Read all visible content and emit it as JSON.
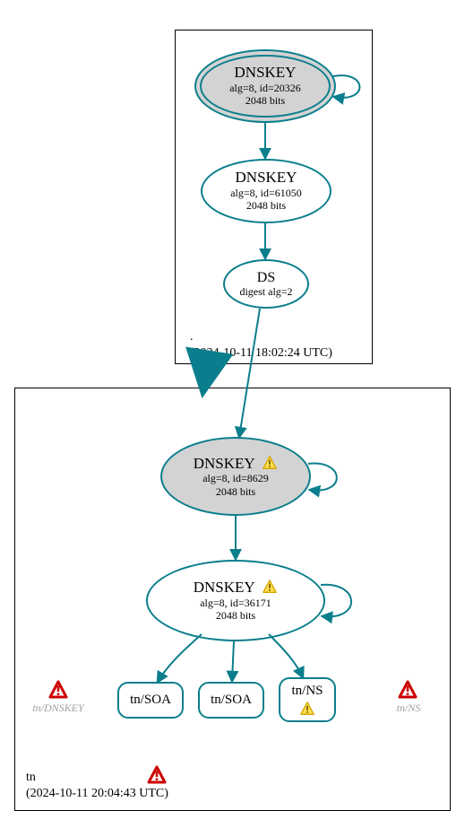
{
  "cluster_root": {
    "name": ".",
    "timestamp": "(2024-10-11 18:02:24 UTC)"
  },
  "cluster_tn": {
    "name": "tn",
    "timestamp": "(2024-10-11 20:04:43 UTC)"
  },
  "nodes": {
    "dnskey1": {
      "title": "DNSKEY",
      "alg": "alg=8, id=20326",
      "bits": "2048 bits"
    },
    "dnskey2": {
      "title": "DNSKEY",
      "alg": "alg=8, id=61050",
      "bits": "2048 bits"
    },
    "ds": {
      "title": "DS",
      "digest": "digest alg=2"
    },
    "dnskey3": {
      "title": "DNSKEY",
      "alg": "alg=8, id=8629",
      "bits": "2048 bits"
    },
    "dnskey4": {
      "title": "DNSKEY",
      "alg": "alg=8, id=36171",
      "bits": "2048 bits"
    }
  },
  "leaves": {
    "soa1": "tn/SOA",
    "soa2": "tn/SOA",
    "ns": "tn/NS"
  },
  "ghosts": {
    "dnskey": "tn/DNSKEY",
    "ns": "tn/NS"
  },
  "colors": {
    "teal": "#0a7e8c",
    "grey": "#d3d3d3",
    "warn_fill": "#ffdf4d",
    "warn_stroke": "#d4a500",
    "err_fill": "#ffffff",
    "err_stroke": "#cc0000"
  }
}
